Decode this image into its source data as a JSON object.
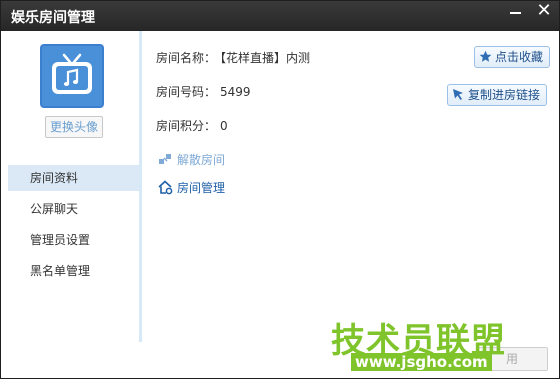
{
  "window": {
    "title": "娱乐房间管理",
    "minimize_glyph": "—",
    "close_glyph": "✕"
  },
  "sidebar": {
    "avatar_icon": "tv-music-icon",
    "change_avatar_label": "更换头像",
    "items": [
      {
        "label": "房间资料",
        "active": true
      },
      {
        "label": "公屏聊天",
        "active": false
      },
      {
        "label": "管理员设置",
        "active": false
      },
      {
        "label": "黑名单管理",
        "active": false
      }
    ]
  },
  "room": {
    "name_label": "房间名称：",
    "name_value": "【花样直播】内测",
    "number_label": "房间号码：",
    "number_value": "5499",
    "points_label": "房间积分：",
    "points_value": "0"
  },
  "actions": {
    "favorite_label": "点击收藏",
    "copy_link_label": "复制进房链接",
    "dissolve_label": "解散房间",
    "manage_label": "房间管理",
    "apply_label": "用"
  },
  "watermark": {
    "main_text": "技术员联盟",
    "url_text": "www.jsgho.com"
  },
  "colors": {
    "titlebar": "#2e2e2e",
    "accent": "#4a90d9",
    "nav_active_bg": "#dbe9f7",
    "link": "#1f5fa8",
    "watermark_green": "#7fc42a"
  }
}
